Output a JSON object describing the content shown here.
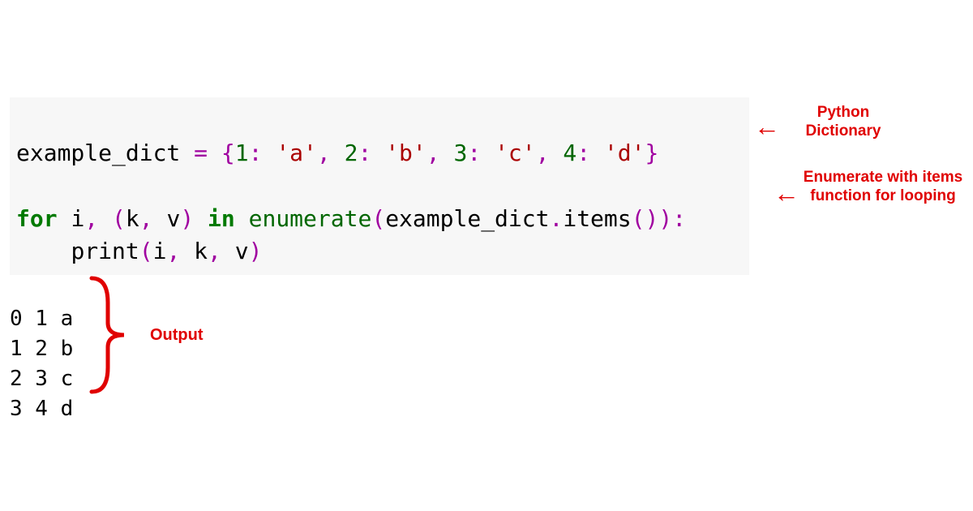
{
  "code": {
    "line1": {
      "t1": "example_dict ",
      "t2": "=",
      "t3": " {",
      "n1": "1",
      "c1": ":",
      "sp": " ",
      "s1": "'a'",
      "cm": ",",
      "n2": "2",
      "s2": "'b'",
      "n3": "3",
      "s3": "'c'",
      "n4": "4",
      "s4": "'d'",
      "t9": "}"
    },
    "blank": "",
    "line2": {
      "k_for": "for",
      "sp": " ",
      "i": "i",
      "cm": ",",
      "op1": " (",
      "k": "k",
      "v": "v",
      "op2": ") ",
      "k_in": "in",
      "fn": "enumerate",
      "op3": "(",
      "ed": "example_dict",
      "op4": ".",
      "items": "items",
      "op5": "()):"
    },
    "line3": {
      "indent": "    ",
      "pr": "print",
      "op": "(",
      "i": "i",
      "cm": ",",
      "sp": " ",
      "k": "k",
      "v": "v",
      "cl": ")"
    }
  },
  "output": {
    "r0": "0 1 a",
    "r1": "1 2 b",
    "r2": "2 3 c",
    "r3": "3 4 d"
  },
  "annot": {
    "dict": "Python Dictionary",
    "enum": "Enumerate with items function for looping",
    "out": "Output"
  }
}
